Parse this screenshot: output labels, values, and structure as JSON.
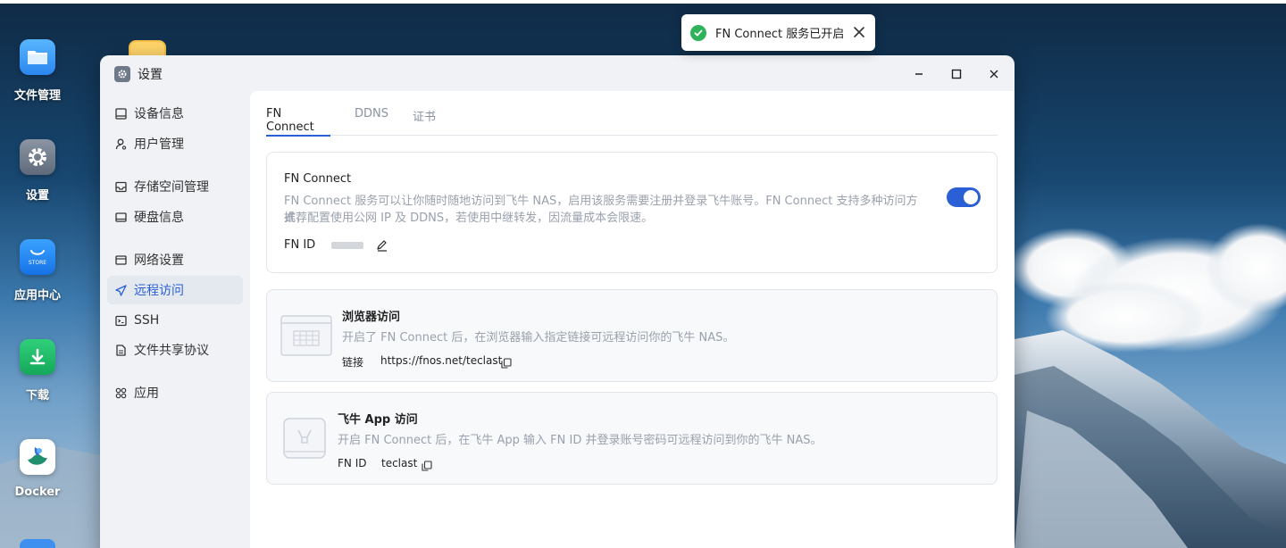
{
  "desktop": {
    "icons": [
      {
        "label": "文件管理",
        "icon": "folder-icon"
      },
      {
        "label": "设置",
        "icon": "gear-icon"
      },
      {
        "label": "应用中心",
        "icon": "store-icon",
        "badge": "STORE"
      },
      {
        "label": "下载",
        "icon": "download-icon"
      },
      {
        "label": "Docker",
        "icon": "docker-icon"
      }
    ]
  },
  "toast": {
    "message": "FN Connect 服务已开启",
    "icon": "check-circle-icon",
    "close_icon": "close-icon"
  },
  "window": {
    "title": "设置",
    "controls": {
      "minimize": "–",
      "maximize": "□",
      "close": "×"
    }
  },
  "sidebar": {
    "items": [
      {
        "label": "设备信息",
        "icon": "device-icon"
      },
      {
        "label": "用户管理",
        "icon": "user-icon"
      },
      {
        "label": "存储空间管理",
        "icon": "storage-icon"
      },
      {
        "label": "硬盘信息",
        "icon": "disk-icon"
      },
      {
        "label": "网络设置",
        "icon": "network-icon"
      },
      {
        "label": "远程访问",
        "icon": "send-icon",
        "active": true
      },
      {
        "label": "SSH",
        "icon": "terminal-icon"
      },
      {
        "label": "文件共享协议",
        "icon": "document-icon"
      },
      {
        "label": "应用",
        "icon": "apps-icon"
      }
    ]
  },
  "tabs": [
    {
      "label": "FN Connect",
      "active": true
    },
    {
      "label": "DDNS"
    },
    {
      "label": "证书"
    }
  ],
  "fn_connect": {
    "title": "FN Connect",
    "description_line1": "FN Connect 服务可以让你随时随地访问到飞牛 NAS，启用该服务需要注册并登录飞牛账号。FN Connect 支持多种访问方式，",
    "description_line2": "推荐配置使用公网 IP 及 DDNS，若使用中继转发，因流量成本会限速。",
    "fn_id_label": "FN ID",
    "enabled": true
  },
  "browser_access": {
    "title": "浏览器访问",
    "description": "开启了 FN Connect 后，在浏览器输入指定链接可远程访问你的飞牛 NAS。",
    "link_label": "链接",
    "link_value": "https://fnos.net/teclast"
  },
  "app_access": {
    "title": "飞牛 App 访问",
    "description": "开启 FN Connect 后，在飞牛 App 输入 FN ID 并登录账号密码可远程访问到你的飞牛 NAS。",
    "id_label": "FN ID",
    "id_value": "teclast"
  },
  "colors": {
    "accent": "#2a5fd6",
    "success": "#2fb35a"
  }
}
